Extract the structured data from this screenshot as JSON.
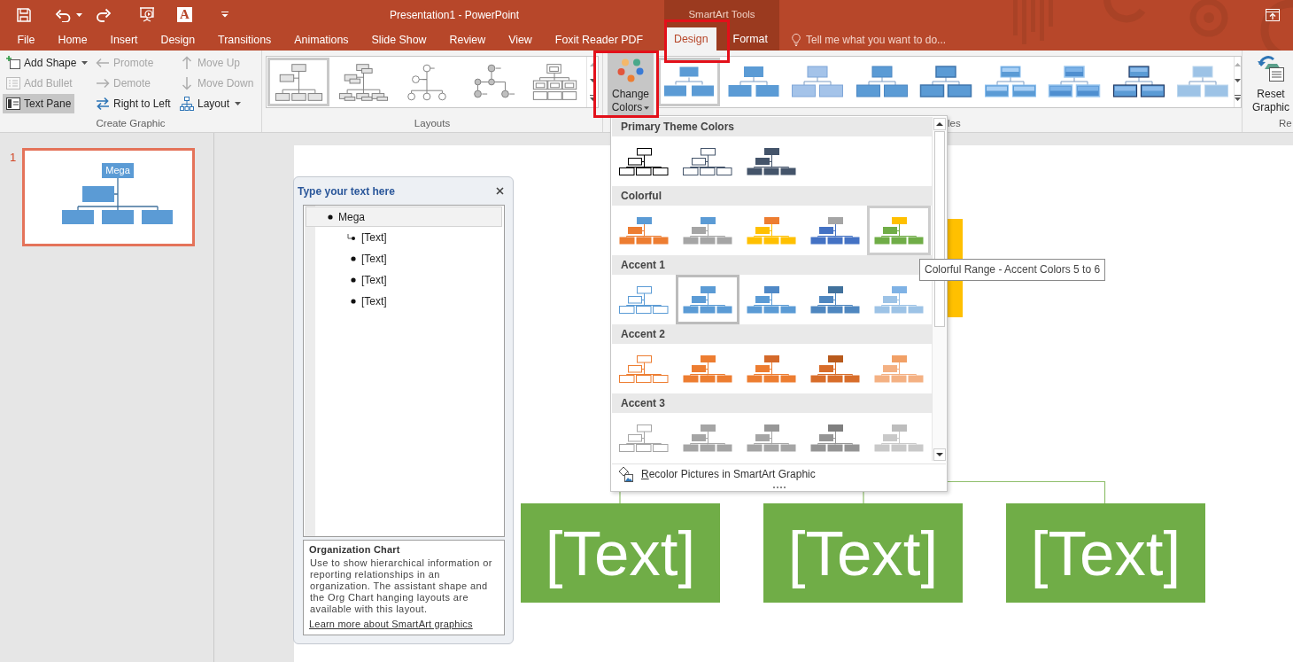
{
  "title_bar": {
    "title": "Presentation1 - PowerPoint",
    "context_title": "SmartArt Tools",
    "qat_glyph": "A"
  },
  "tabs": [
    {
      "label": "File",
      "kind": "main",
      "selected": false
    },
    {
      "label": "Home",
      "kind": "main",
      "selected": false
    },
    {
      "label": "Insert",
      "kind": "main",
      "selected": false
    },
    {
      "label": "Design",
      "kind": "main",
      "selected": false
    },
    {
      "label": "Transitions",
      "kind": "main",
      "selected": false
    },
    {
      "label": "Animations",
      "kind": "main",
      "selected": false
    },
    {
      "label": "Slide Show",
      "kind": "main",
      "selected": false
    },
    {
      "label": "Review",
      "kind": "main",
      "selected": false
    },
    {
      "label": "View",
      "kind": "main",
      "selected": false
    },
    {
      "label": "Foxit Reader PDF",
      "kind": "main",
      "selected": false
    },
    {
      "label": "Design",
      "kind": "context",
      "selected": true
    },
    {
      "label": "Format",
      "kind": "context",
      "selected": false
    }
  ],
  "tell_me": {
    "placeholder": "Tell me what you want to do..."
  },
  "ribbon": {
    "create_graphic": {
      "label": "Create Graphic",
      "commands": [
        {
          "label": "Add Shape",
          "disabled": false,
          "on": false,
          "dropdown": true
        },
        {
          "label": "Add Bullet",
          "disabled": true,
          "on": false,
          "dropdown": false
        },
        {
          "label": "Text Pane",
          "disabled": false,
          "on": true,
          "dropdown": false
        },
        {
          "label": "Promote",
          "disabled": true,
          "on": false,
          "dropdown": false
        },
        {
          "label": "Demote",
          "disabled": true,
          "on": false,
          "dropdown": false
        },
        {
          "label": "Right to Left",
          "disabled": false,
          "on": false,
          "dropdown": false
        },
        {
          "label": "Move Up",
          "disabled": true,
          "on": false,
          "dropdown": false
        },
        {
          "label": "Move Down",
          "disabled": true,
          "on": false,
          "dropdown": false
        },
        {
          "label": "Layout",
          "disabled": false,
          "on": false,
          "dropdown": true
        }
      ]
    },
    "layouts": {
      "label": "Layouts",
      "items": [
        {
          "selected": true
        },
        {
          "selected": false
        },
        {
          "selected": false
        },
        {
          "selected": false
        },
        {
          "selected": false
        }
      ]
    },
    "smartart_styles": {
      "change_colors": {
        "label": "Change Colors",
        "expanded": true
      },
      "items": [
        {
          "selected": true
        },
        {
          "selected": false
        },
        {
          "selected": false
        },
        {
          "selected": false
        },
        {
          "selected": false
        },
        {
          "selected": false
        },
        {
          "selected": false
        },
        {
          "selected": false
        },
        {
          "selected": false
        }
      ],
      "label": "les"
    },
    "reset": {
      "button": "Reset Graphic",
      "label": "Re"
    }
  },
  "slide_thumbnails": [
    {
      "number": "1",
      "label": "Mega",
      "selected": true
    }
  ],
  "text_pane": {
    "title": "Type your text here",
    "items": [
      {
        "text": "Mega",
        "kind": "bullet",
        "selected": true,
        "children": [
          {
            "text": "[Text]",
            "kind": "assistant",
            "selected": false
          },
          {
            "text": "[Text]",
            "kind": "bullet",
            "selected": false
          },
          {
            "text": "[Text]",
            "kind": "bullet",
            "selected": false
          },
          {
            "text": "[Text]",
            "kind": "bullet",
            "selected": false
          }
        ]
      }
    ],
    "description": {
      "title": "Organization Chart",
      "body": "Use to show hierarchical information or reporting relationships in an organization. The assistant shape and the Org Chart hanging layouts are available with this layout.",
      "link": "Learn more about SmartArt graphics"
    }
  },
  "slide": {
    "shapes": [
      {
        "text": "[Text]"
      },
      {
        "text": "[Text]"
      },
      {
        "text": "[Text]"
      }
    ]
  },
  "color_menu": {
    "sections": [
      {
        "title": "Primary Theme Colors",
        "options": [
          {
            "kind": "outline",
            "selected": false,
            "hovered": false,
            "parts": [
              {
                "color": "#000000"
              }
            ]
          },
          {
            "kind": "outline",
            "selected": false,
            "hovered": false,
            "parts": [
              {
                "color": "#44546a"
              }
            ]
          },
          {
            "kind": "fill",
            "selected": false,
            "hovered": false,
            "parts": [
              {
                "color": "#44546a"
              }
            ]
          }
        ]
      },
      {
        "title": "Colorful",
        "options": [
          {
            "kind": "fill",
            "selected": false,
            "hovered": false,
            "parts": [
              {
                "color": "#5b9bd5"
              },
              {
                "color": "#ed7d31"
              }
            ]
          },
          {
            "kind": "fill",
            "selected": false,
            "hovered": false,
            "parts": [
              {
                "color": "#5b9bd5"
              },
              {
                "color": "#a5a5a5"
              }
            ]
          },
          {
            "kind": "fill",
            "selected": false,
            "hovered": false,
            "parts": [
              {
                "color": "#ed7d31"
              },
              {
                "color": "#ffc000"
              }
            ]
          },
          {
            "kind": "fill",
            "selected": false,
            "hovered": false,
            "parts": [
              {
                "color": "#a5a5a5"
              },
              {
                "color": "#4472c4"
              }
            ]
          },
          {
            "kind": "fill",
            "selected": false,
            "hovered": true,
            "parts": [
              {
                "color": "#ffc000"
              },
              {
                "color": "#70ad47"
              }
            ]
          }
        ]
      },
      {
        "title": "Accent 1",
        "options": [
          {
            "kind": "outline",
            "selected": false,
            "hovered": false,
            "parts": [
              {
                "color": "#5b9bd5"
              }
            ]
          },
          {
            "kind": "fill",
            "selected": true,
            "hovered": false,
            "parts": [
              {
                "color": "#5b9bd5"
              }
            ]
          },
          {
            "kind": "fill",
            "selected": false,
            "hovered": false,
            "parts": [
              {
                "color": "#4f88c6"
              },
              {
                "color": "#5b9bd5"
              }
            ]
          },
          {
            "kind": "fill",
            "selected": false,
            "hovered": false,
            "parts": [
              {
                "color": "#41719c"
              },
              {
                "color": "#4f87c0"
              }
            ]
          },
          {
            "kind": "fill",
            "selected": false,
            "hovered": false,
            "parts": [
              {
                "color": "#7fb2e5"
              },
              {
                "color": "#9dc3e6"
              }
            ]
          }
        ]
      },
      {
        "title": "Accent 2",
        "options": [
          {
            "kind": "outline",
            "selected": false,
            "hovered": false,
            "parts": [
              {
                "color": "#ed7d31"
              }
            ]
          },
          {
            "kind": "fill",
            "selected": false,
            "hovered": false,
            "parts": [
              {
                "color": "#ed7d31"
              }
            ]
          },
          {
            "kind": "fill",
            "selected": false,
            "hovered": false,
            "parts": [
              {
                "color": "#d4692a"
              },
              {
                "color": "#ed7d31"
              }
            ]
          },
          {
            "kind": "fill",
            "selected": false,
            "hovered": false,
            "parts": [
              {
                "color": "#b85a1c"
              },
              {
                "color": "#d86d2a"
              }
            ]
          },
          {
            "kind": "fill",
            "selected": false,
            "hovered": false,
            "parts": [
              {
                "color": "#f1a066"
              },
              {
                "color": "#f4b183"
              }
            ]
          }
        ]
      },
      {
        "title": "Accent 3",
        "options": [
          {
            "kind": "outline",
            "selected": false,
            "hovered": false,
            "parts": [
              {
                "color": "#a5a5a5"
              }
            ]
          },
          {
            "kind": "fill",
            "selected": false,
            "hovered": false,
            "parts": [
              {
                "color": "#a5a5a5"
              }
            ]
          },
          {
            "kind": "fill",
            "selected": false,
            "hovered": false,
            "parts": [
              {
                "color": "#979797"
              },
              {
                "color": "#a5a5a5"
              }
            ]
          },
          {
            "kind": "fill",
            "selected": false,
            "hovered": false,
            "parts": [
              {
                "color": "#7f7f7f"
              },
              {
                "color": "#959595"
              }
            ]
          },
          {
            "kind": "fill",
            "selected": false,
            "hovered": false,
            "parts": [
              {
                "color": "#bdbdbd"
              },
              {
                "color": "#c9c9c9"
              }
            ]
          }
        ]
      }
    ],
    "footer": "Recolor Pictures in SmartArt Graphic"
  },
  "tooltip": {
    "text": "Colorful Range - Accent Colors 5 to 6"
  }
}
